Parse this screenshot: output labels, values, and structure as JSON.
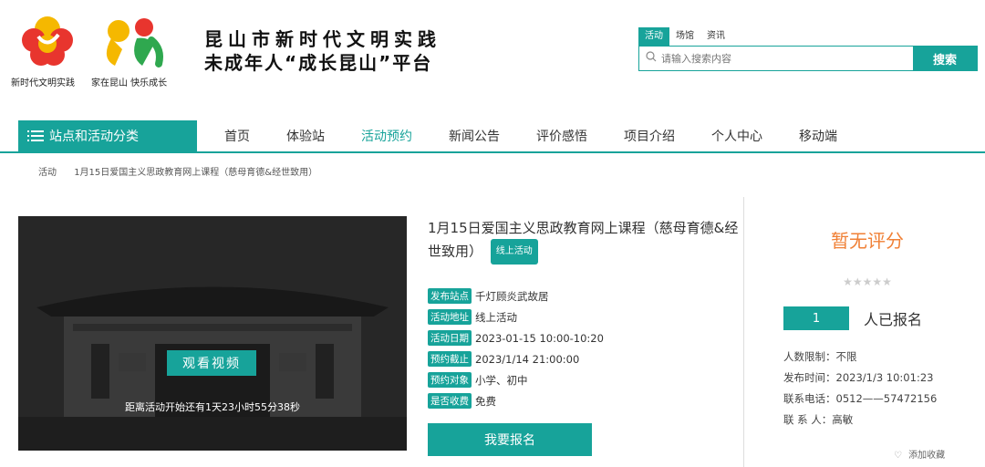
{
  "header": {
    "logo1_caption": "新时代文明实践",
    "logo2_caption": "家在昆山 快乐成长",
    "title_line1": "昆山市新时代文明实践",
    "title_line2": "未成年人“成长昆山”平台"
  },
  "search": {
    "tabs": [
      "活动",
      "场馆",
      "资讯"
    ],
    "active_tab": "活动",
    "placeholder": "请输入搜索内容",
    "button": "搜索"
  },
  "nav": {
    "category": "站点和活动分类",
    "items": [
      "首页",
      "体验站",
      "活动预约",
      "新闻公告",
      "评价感悟",
      "项目介绍",
      "个人中心",
      "移动端"
    ],
    "active": "活动预约"
  },
  "breadcrumb": {
    "root": "活动",
    "current": "1月15日爱国主义思政教育网上课程（慈母育德&经世致用）"
  },
  "video": {
    "play_label": "观看视频",
    "countdown": "距离活动开始还有1天23小时55分38秒"
  },
  "activity": {
    "title": "1月15日爱国主义思政教育网上课程（慈母育德&经世致用）",
    "badge": "线上活动",
    "details": [
      {
        "tag": "发布站点",
        "value": "千灯顾炎武故居"
      },
      {
        "tag": "活动地址",
        "value": "线上活动"
      },
      {
        "tag": "活动日期",
        "value": "2023-01-15 10:00-10:20"
      },
      {
        "tag": "预约截止",
        "value": "2023/1/14 21:00:00"
      },
      {
        "tag": "预约对象",
        "value": "小学、初中"
      },
      {
        "tag": "是否收费",
        "value": "免费"
      }
    ],
    "signup_button": "我要报名"
  },
  "sidebar": {
    "rating": "暂无评分",
    "stars": "★★★★★",
    "signup_count": "1",
    "signup_label": "人已报名",
    "limit": "人数限制：不限",
    "publish_time": "发布时间：2023/1/3 10:01:23",
    "phone": "联系电话：0512——57472156",
    "contact": "联 系 人：高敏",
    "favorite": "添加收藏"
  },
  "colors": {
    "brand": "#17a39a",
    "rating": "#f08036"
  }
}
